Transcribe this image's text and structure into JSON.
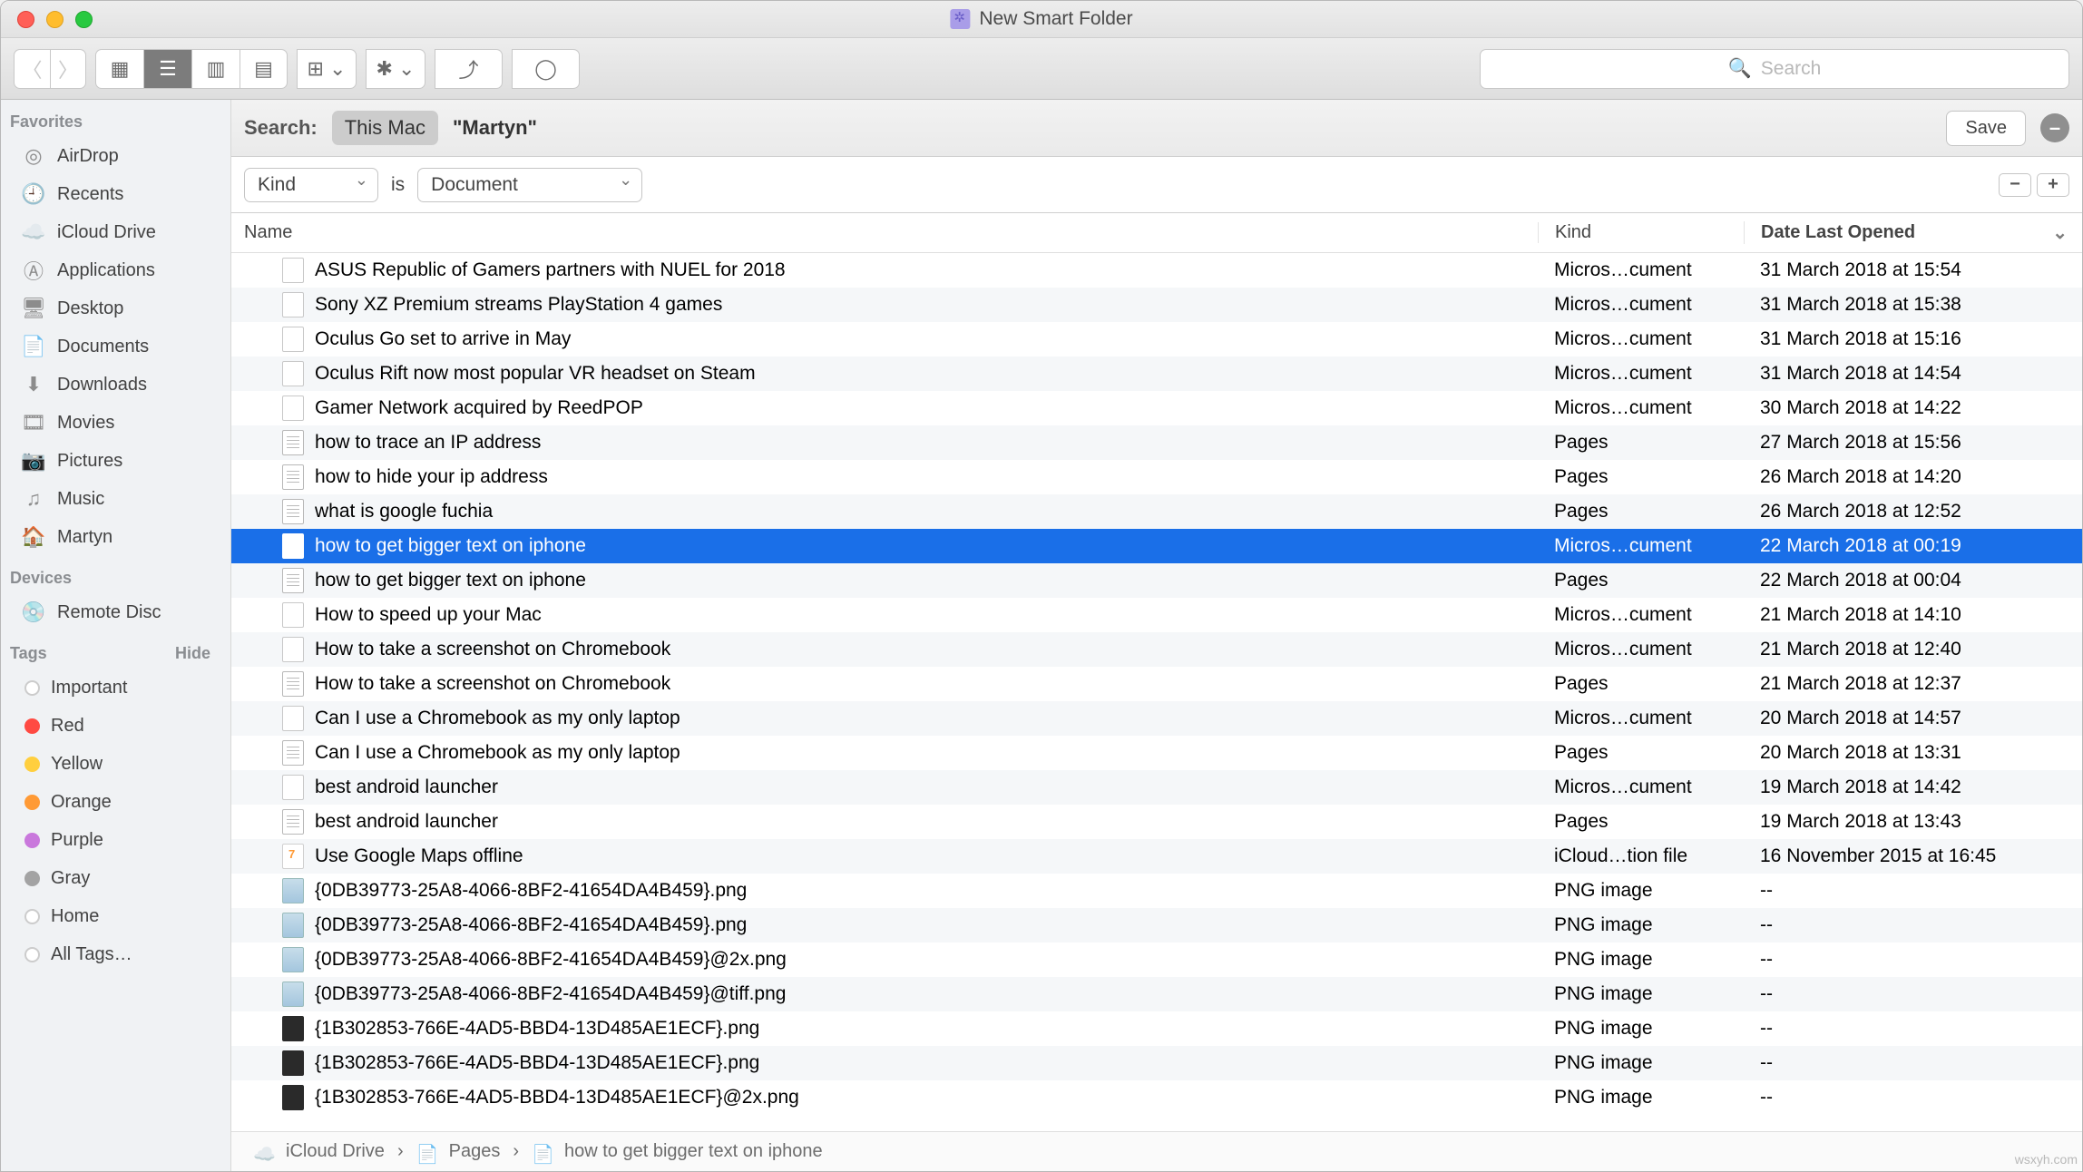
{
  "window": {
    "title": "New Smart Folder"
  },
  "toolbar": {
    "search_placeholder": "Search"
  },
  "sidebar": {
    "favorites_label": "Favorites",
    "favorites": [
      {
        "icon": "airdrop",
        "label": "AirDrop"
      },
      {
        "icon": "recents",
        "label": "Recents"
      },
      {
        "icon": "icloud",
        "label": "iCloud Drive"
      },
      {
        "icon": "apps",
        "label": "Applications"
      },
      {
        "icon": "desktop",
        "label": "Desktop"
      },
      {
        "icon": "docs",
        "label": "Documents"
      },
      {
        "icon": "downloads",
        "label": "Downloads"
      },
      {
        "icon": "movies",
        "label": "Movies"
      },
      {
        "icon": "pictures",
        "label": "Pictures"
      },
      {
        "icon": "music",
        "label": "Music"
      },
      {
        "icon": "home",
        "label": "Martyn"
      }
    ],
    "devices_label": "Devices",
    "devices": [
      {
        "icon": "disc",
        "label": "Remote Disc"
      }
    ],
    "tags_label": "Tags",
    "hide_label": "Hide",
    "tags": [
      {
        "cls": "tag-empty",
        "label": "Important"
      },
      {
        "cls": "tag-red",
        "label": "Red"
      },
      {
        "cls": "tag-yellow",
        "label": "Yellow"
      },
      {
        "cls": "tag-orange",
        "label": "Orange"
      },
      {
        "cls": "tag-purple",
        "label": "Purple"
      },
      {
        "cls": "tag-gray",
        "label": "Gray"
      },
      {
        "cls": "tag-empty",
        "label": "Home"
      },
      {
        "cls": "tag-empty",
        "label": "All Tags…"
      }
    ]
  },
  "searchbar": {
    "label": "Search:",
    "scope_active": "This Mac",
    "scope_other": "\"Martyn\"",
    "save": "Save",
    "minus": "–"
  },
  "criteria": {
    "attr": "Kind",
    "is": "is",
    "value": "Document",
    "minus": "−",
    "plus": "+"
  },
  "columns": {
    "name": "Name",
    "kind": "Kind",
    "date": "Date Last Opened"
  },
  "rows": [
    {
      "icon": "doc",
      "name": "ASUS Republic of Gamers partners with NUEL for 2018",
      "kind": "Micros…cument",
      "date": "31 March 2018 at 15:54"
    },
    {
      "icon": "doc",
      "name": "Sony XZ Premium streams PlayStation 4 games",
      "kind": "Micros…cument",
      "date": "31 March 2018 at 15:38"
    },
    {
      "icon": "doc",
      "name": "Oculus Go set to arrive in May",
      "kind": "Micros…cument",
      "date": "31 March 2018 at 15:16"
    },
    {
      "icon": "doc",
      "name": "Oculus Rift now most popular VR headset on Steam",
      "kind": "Micros…cument",
      "date": "31 March 2018 at 14:54"
    },
    {
      "icon": "doc",
      "name": "Gamer Network acquired by ReedPOP",
      "kind": "Micros…cument",
      "date": "30 March 2018 at 14:22"
    },
    {
      "icon": "pages",
      "name": "how to trace an IP address",
      "kind": "Pages",
      "date": "27 March 2018 at 15:56"
    },
    {
      "icon": "pages",
      "name": "how to hide your ip address",
      "kind": "Pages",
      "date": "26 March 2018 at 14:20"
    },
    {
      "icon": "pages",
      "name": "what is google fuchia",
      "kind": "Pages",
      "date": "26 March 2018 at 12:52"
    },
    {
      "icon": "doc",
      "name": "how to get bigger text on iphone",
      "kind": "Micros…cument",
      "date": "22 March 2018 at 00:19",
      "selected": true
    },
    {
      "icon": "pages",
      "name": "how to get bigger text on iphone",
      "kind": "Pages",
      "date": "22 March 2018 at 00:04"
    },
    {
      "icon": "doc",
      "name": "How to speed up your Mac",
      "kind": "Micros…cument",
      "date": "21 March 2018 at 14:10"
    },
    {
      "icon": "doc",
      "name": "How to take a screenshot on Chromebook",
      "kind": "Micros…cument",
      "date": "21 March 2018 at 12:40"
    },
    {
      "icon": "pages",
      "name": "How to take a screenshot on Chromebook",
      "kind": "Pages",
      "date": "21 March 2018 at 12:37"
    },
    {
      "icon": "doc",
      "name": "Can I use a Chromebook as my only laptop",
      "kind": "Micros…cument",
      "date": "20 March 2018 at 14:57"
    },
    {
      "icon": "pages",
      "name": "Can I use a Chromebook as my only laptop",
      "kind": "Pages",
      "date": "20 March 2018 at 13:31"
    },
    {
      "icon": "doc",
      "name": "best android launcher",
      "kind": "Micros…cument",
      "date": "19 March 2018 at 14:42"
    },
    {
      "icon": "pages",
      "name": "best android launcher",
      "kind": "Pages",
      "date": "19 March 2018 at 13:43"
    },
    {
      "icon": "seven",
      "name": "Use Google Maps offline",
      "kind": "iCloud…tion file",
      "date": "16 November 2015 at 16:45"
    },
    {
      "icon": "png2",
      "name": "{0DB39773-25A8-4066-8BF2-41654DA4B459}.png",
      "kind": "PNG image",
      "date": "--"
    },
    {
      "icon": "png2",
      "name": "{0DB39773-25A8-4066-8BF2-41654DA4B459}.png",
      "kind": "PNG image",
      "date": "--"
    },
    {
      "icon": "png2",
      "name": "{0DB39773-25A8-4066-8BF2-41654DA4B459}@2x.png",
      "kind": "PNG image",
      "date": "--"
    },
    {
      "icon": "png2",
      "name": "{0DB39773-25A8-4066-8BF2-41654DA4B459}@tiff.png",
      "kind": "PNG image",
      "date": "--"
    },
    {
      "icon": "png",
      "name": "{1B302853-766E-4AD5-BBD4-13D485AE1ECF}.png",
      "kind": "PNG image",
      "date": "--"
    },
    {
      "icon": "png",
      "name": "{1B302853-766E-4AD5-BBD4-13D485AE1ECF}.png",
      "kind": "PNG image",
      "date": "--"
    },
    {
      "icon": "png",
      "name": "{1B302853-766E-4AD5-BBD4-13D485AE1ECF}@2x.png",
      "kind": "PNG image",
      "date": "--"
    }
  ],
  "pathbar": [
    {
      "icon": "cloud",
      "label": "iCloud Drive"
    },
    {
      "icon": "seven",
      "label": "Pages"
    },
    {
      "icon": "doc",
      "label": "how to get bigger text on iphone"
    }
  ],
  "watermark": "wsxyh.com"
}
